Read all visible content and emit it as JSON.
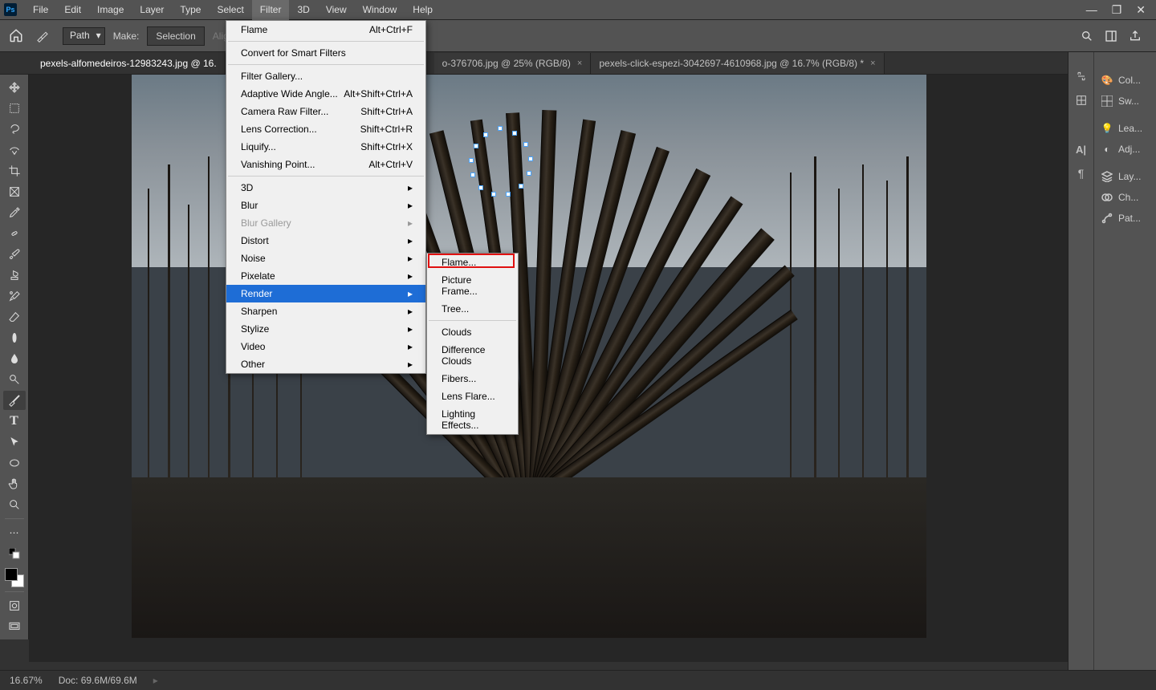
{
  "menubar": {
    "items": [
      "File",
      "Edit",
      "Image",
      "Layer",
      "Type",
      "Select",
      "Filter",
      "3D",
      "View",
      "Window",
      "Help"
    ],
    "active_index": 6
  },
  "optionsbar": {
    "path_mode": "Path",
    "make_label": "Make:",
    "selection_btn": "Selection",
    "align_label": "Align Edges"
  },
  "tabs": [
    {
      "label": "pexels-alfomedeiros-12983243.jpg @ 16.",
      "active": true
    },
    {
      "label": "o-376706.jpg @ 25% (RGB/8)",
      "active": false,
      "partial": true
    },
    {
      "label": "pexels-click-espezi-3042697-4610968.jpg @ 16.7% (RGB/8) *",
      "active": false
    }
  ],
  "filter_menu": {
    "top_item": {
      "label": "Flame",
      "shortcut": "Alt+Ctrl+F"
    },
    "convert": "Convert for Smart Filters",
    "group1": [
      {
        "label": "Filter Gallery...",
        "shortcut": ""
      },
      {
        "label": "Adaptive Wide Angle...",
        "shortcut": "Alt+Shift+Ctrl+A"
      },
      {
        "label": "Camera Raw Filter...",
        "shortcut": "Shift+Ctrl+A"
      },
      {
        "label": "Lens Correction...",
        "shortcut": "Shift+Ctrl+R"
      },
      {
        "label": "Liquify...",
        "shortcut": "Shift+Ctrl+X"
      },
      {
        "label": "Vanishing Point...",
        "shortcut": "Alt+Ctrl+V"
      }
    ],
    "group2": [
      {
        "label": "3D",
        "sub": true
      },
      {
        "label": "Blur",
        "sub": true
      },
      {
        "label": "Blur Gallery",
        "sub": true,
        "dim": true
      },
      {
        "label": "Distort",
        "sub": true
      },
      {
        "label": "Noise",
        "sub": true
      },
      {
        "label": "Pixelate",
        "sub": true
      },
      {
        "label": "Render",
        "sub": true,
        "hi": true
      },
      {
        "label": "Sharpen",
        "sub": true
      },
      {
        "label": "Stylize",
        "sub": true
      },
      {
        "label": "Video",
        "sub": true
      },
      {
        "label": "Other",
        "sub": true
      }
    ]
  },
  "render_submenu": {
    "group1": [
      "Flame...",
      "Picture Frame...",
      "Tree..."
    ],
    "group2": [
      "Clouds",
      "Difference Clouds",
      "Fibers...",
      "Lens Flare...",
      "Lighting Effects..."
    ]
  },
  "right_panels": {
    "items": [
      "Col...",
      "Sw...",
      "Lea...",
      "Adj...",
      "Lay...",
      "Ch...",
      "Pat..."
    ]
  },
  "status": {
    "zoom": "16.67%",
    "doc": "Doc: 69.6M/69.6M"
  }
}
